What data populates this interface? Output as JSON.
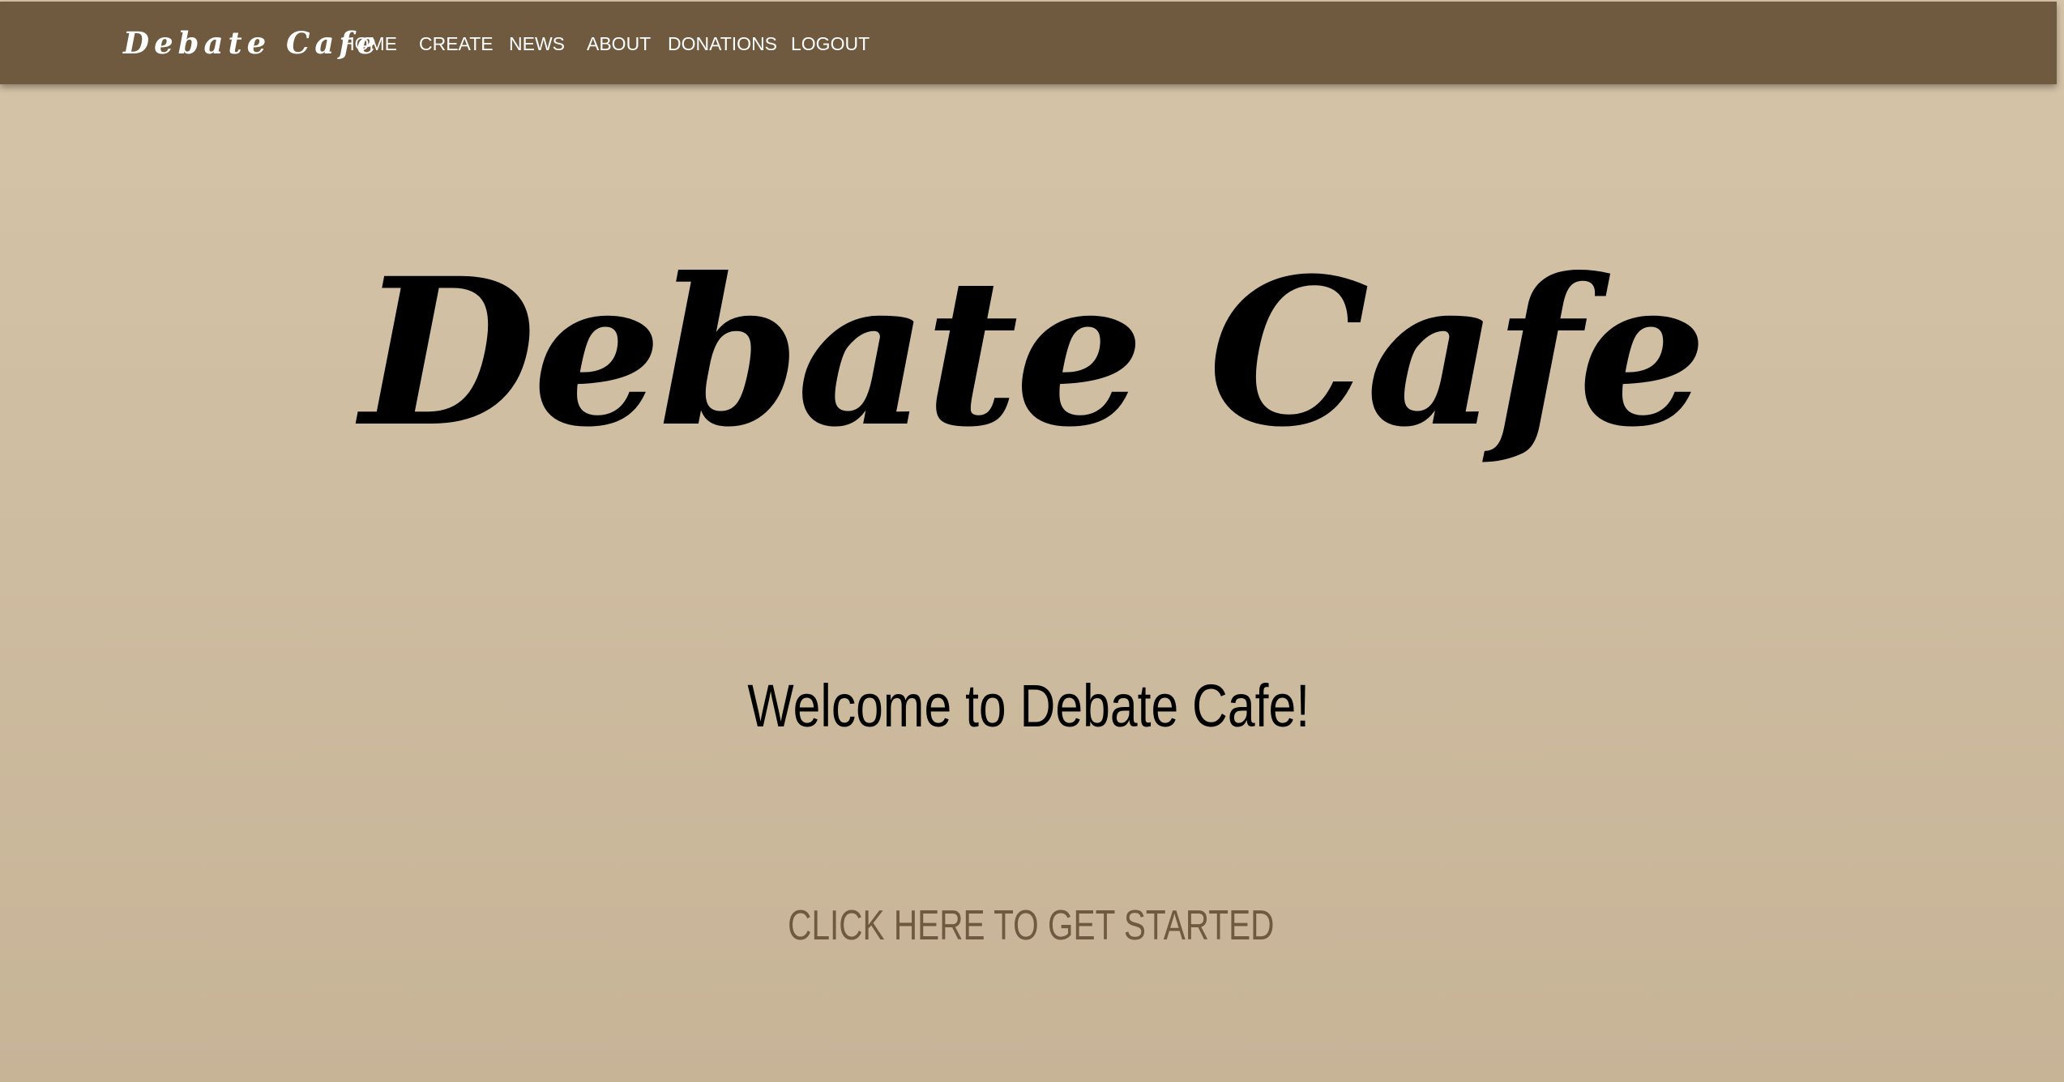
{
  "navbar": {
    "brand": "Debate Cafe",
    "links": [
      {
        "label": "HOME"
      },
      {
        "label": "CREATE"
      },
      {
        "label": "NEWS"
      },
      {
        "label": "ABOUT"
      },
      {
        "label": "DONATIONS"
      },
      {
        "label": "LOGOUT"
      }
    ]
  },
  "hero": {
    "title": "Debate Cafe",
    "welcome": "Welcome to Debate Cafe!",
    "cta": "CLICK HERE TO GET STARTED"
  },
  "colors": {
    "navbar_background": "#6f5a3f",
    "page_background": "#d2c0a4",
    "cta_text": "#6f5a3f",
    "heading_text": "#000000"
  }
}
